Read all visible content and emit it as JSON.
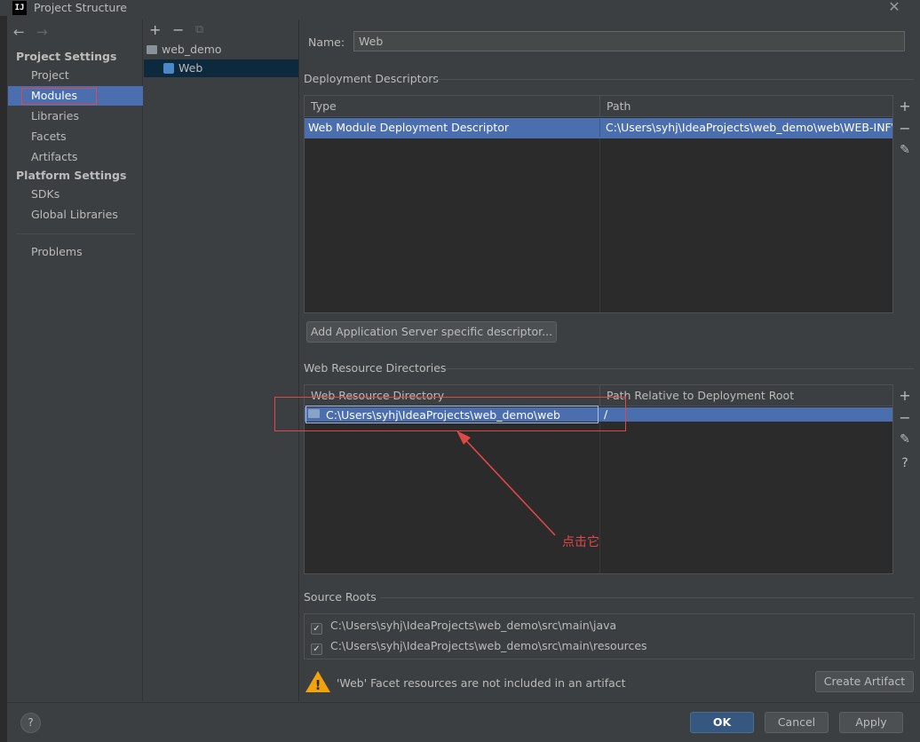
{
  "window": {
    "title": "Project Structure",
    "logo": "IJ",
    "close": "✕"
  },
  "nav": {
    "back": "←",
    "forward": "→"
  },
  "sidebar": {
    "project_settings": "Project Settings",
    "project_items": [
      {
        "label": "Project"
      },
      {
        "label": "Modules"
      },
      {
        "label": "Libraries"
      },
      {
        "label": "Facets"
      },
      {
        "label": "Artifacts"
      }
    ],
    "platform_settings": "Platform Settings",
    "platform_items": [
      {
        "label": "SDKs"
      },
      {
        "label": "Global Libraries"
      }
    ],
    "problems": "Problems"
  },
  "tree": {
    "add": "+",
    "remove": "−",
    "copy": "⧉",
    "root": "web_demo",
    "child": "Web"
  },
  "main": {
    "name_label": "Name:",
    "name_value": "Web",
    "deployment": {
      "title": "Deployment Descriptors",
      "col_type": "Type",
      "col_path": "Path",
      "rows": [
        {
          "type": "Web Module Deployment Descriptor",
          "path": "C:\\Users\\syhj\\IdeaProjects\\web_demo\\web\\WEB-INF\\web.xml"
        }
      ],
      "add_server_btn": "Add Application Server specific descriptor..."
    },
    "web_resources": {
      "title": "Web Resource Directories",
      "col_dir": "Web Resource Directory",
      "col_rel": "Path Relative to Deployment Root",
      "rows": [
        {
          "dir": "C:\\Users\\syhj\\IdeaProjects\\web_demo\\web",
          "rel": "/"
        }
      ]
    },
    "annotation": "点击它",
    "source_roots": {
      "title": "Source Roots",
      "items": [
        {
          "path": "C:\\Users\\syhj\\IdeaProjects\\web_demo\\src\\main\\java",
          "checked": true
        },
        {
          "path": "C:\\Users\\syhj\\IdeaProjects\\web_demo\\src\\main\\resources",
          "checked": true
        }
      ]
    },
    "warning": "'Web' Facet resources are not included in an artifact",
    "create_artifact": "Create Artifact"
  },
  "footer": {
    "help": "?",
    "ok": "OK",
    "cancel": "Cancel",
    "apply": "Apply"
  },
  "toolbar_icons": {
    "add": "+",
    "remove": "−",
    "edit": "✎",
    "help": "?",
    "check": "✓",
    "warn": "!"
  },
  "colors": {
    "selection": "#4b6eaf",
    "annotation": "#e04848",
    "background": "#3c3f41"
  }
}
